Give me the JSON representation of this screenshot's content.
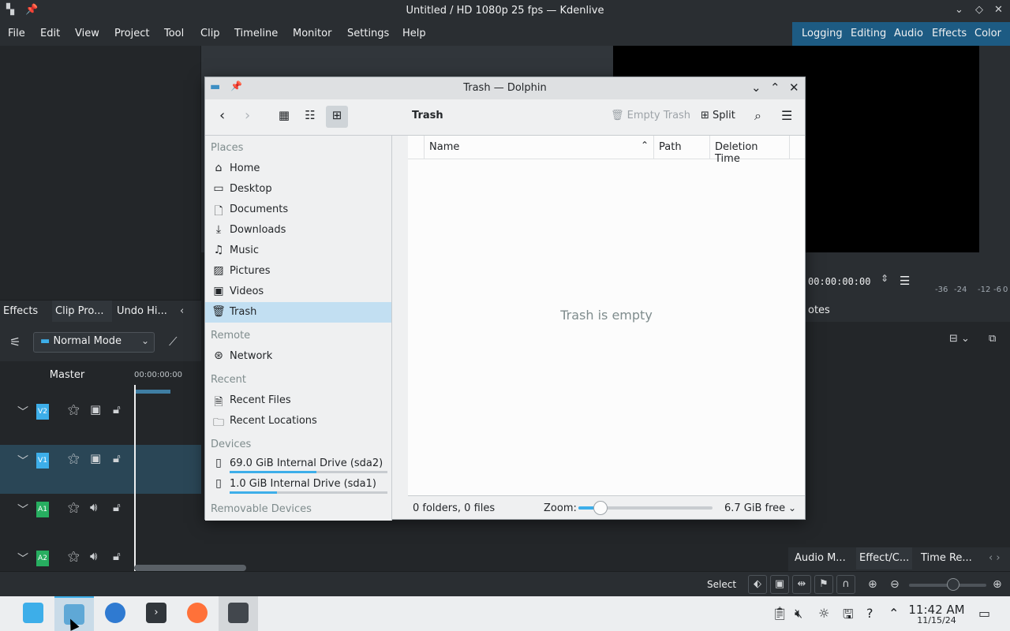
{
  "kdenlive": {
    "title": "Untitled / HD 1080p 25 fps — Kdenlive",
    "menu": [
      "File",
      "Edit",
      "View",
      "Project",
      "Tool",
      "Clip",
      "Timeline",
      "Monitor",
      "Settings",
      "Help"
    ],
    "workspaces": [
      "Logging",
      "Editing",
      "Audio",
      "Effects",
      "Color"
    ],
    "active_workspace": "Logging",
    "timecode": "00:00:00:00",
    "meter_labels": [
      "-36",
      "-24",
      "-12",
      "-6",
      "0"
    ],
    "left_tabs": [
      "Effects",
      "Clip Pro...",
      "Undo Hi..."
    ],
    "notes_tab_fragment": "otes",
    "mode": "Normal Mode",
    "master_label": "Master",
    "ruler_time": "00:00:00:00",
    "tracks": [
      {
        "label": "V2",
        "type": "video"
      },
      {
        "label": "V1",
        "type": "video"
      },
      {
        "label": "A1",
        "type": "audio"
      },
      {
        "label": "A2",
        "type": "audio"
      }
    ],
    "right_dock_tabs": [
      "Audio M...",
      "Effect/C...",
      "Time Re..."
    ],
    "status_select": "Select"
  },
  "dolphin": {
    "title": "Trash — Dolphin",
    "location": "Trash",
    "empty_trash": "Empty Trash",
    "split": "Split",
    "sections": {
      "places": "Places",
      "remote": "Remote",
      "recent": "Recent",
      "devices": "Devices",
      "removable": "Removable Devices"
    },
    "places": [
      {
        "label": "Home",
        "icon": "home-icon"
      },
      {
        "label": "Desktop",
        "icon": "desktop-icon"
      },
      {
        "label": "Documents",
        "icon": "documents-icon"
      },
      {
        "label": "Downloads",
        "icon": "downloads-icon"
      },
      {
        "label": "Music",
        "icon": "music-icon"
      },
      {
        "label": "Pictures",
        "icon": "pictures-icon"
      },
      {
        "label": "Videos",
        "icon": "videos-icon"
      },
      {
        "label": "Trash",
        "icon": "trash-icon"
      }
    ],
    "remote": [
      {
        "label": "Network",
        "icon": "network-icon"
      }
    ],
    "recent": [
      {
        "label": "Recent Files",
        "icon": "recent-files-icon"
      },
      {
        "label": "Recent Locations",
        "icon": "recent-locations-icon"
      }
    ],
    "devices": [
      {
        "label": "69.0 GiB Internal Drive (sda2)",
        "used_fraction": 0.55
      },
      {
        "label": "1.0 GiB Internal Drive (sda1)",
        "used_fraction": 0.3
      }
    ],
    "columns": [
      "Name",
      "Path",
      "Deletion Time"
    ],
    "empty_message": "Trash is empty",
    "status_counts": "0 folders, 0 files",
    "zoom_label": "Zoom:",
    "free_space": "6.7 GiB free",
    "selected_place": "Trash"
  },
  "taskbar": {
    "time": "11:42 AM",
    "date": "11/15/24",
    "apps": [
      "app-launcher",
      "dolphin",
      "chromium",
      "terminal",
      "firefox",
      "kdenlive"
    ]
  }
}
